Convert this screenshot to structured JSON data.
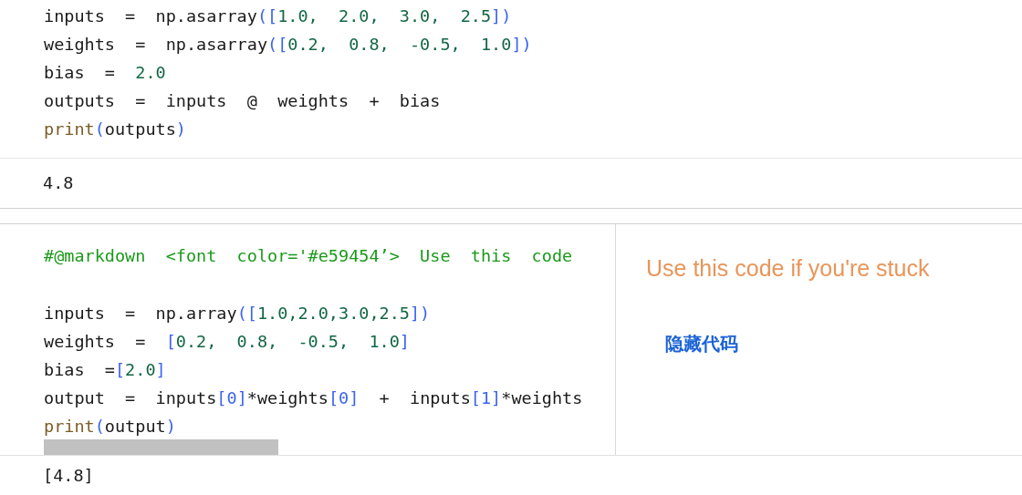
{
  "cells": [
    {
      "code": [
        {
          "tokens": [
            {
              "t": "inputs  =  np.asarray",
              "kind": "plain"
            },
            {
              "t": "([",
              "kind": "bracket"
            },
            {
              "t": "1.0,  2.0,  3.0,  2.5",
              "kind": "number"
            },
            {
              "t": "])",
              "kind": "bracket"
            }
          ]
        },
        {
          "tokens": [
            {
              "t": "weights  =  np.asarray",
              "kind": "plain"
            },
            {
              "t": "([",
              "kind": "bracket"
            },
            {
              "t": "0.2,  0.8,  -0.5,  1.0",
              "kind": "number"
            },
            {
              "t": "])",
              "kind": "bracket"
            }
          ]
        },
        {
          "tokens": [
            {
              "t": "bias  =  ",
              "kind": "plain"
            },
            {
              "t": "2.0",
              "kind": "number"
            }
          ]
        },
        {
          "tokens": [
            {
              "t": "outputs  =  inputs  @  weights  +  bias",
              "kind": "plain"
            }
          ]
        },
        {
          "tokens": [
            {
              "t": "print",
              "kind": "builtin"
            },
            {
              "t": "(",
              "kind": "bracket"
            },
            {
              "t": "outputs",
              "kind": "plain"
            },
            {
              "t": ")",
              "kind": "bracket"
            }
          ]
        }
      ],
      "output": "4.8"
    },
    {
      "comment": "#@markdown  <font  color='#e59454’>  Use  this  code",
      "code": [
        {
          "tokens": [
            {
              "t": "inputs  =  np.array",
              "kind": "plain"
            },
            {
              "t": "([",
              "kind": "bracket"
            },
            {
              "t": "1.0,2.0,3.0,2.5",
              "kind": "number"
            },
            {
              "t": "])",
              "kind": "bracket"
            }
          ]
        },
        {
          "tokens": [
            {
              "t": "weights  =  ",
              "kind": "plain"
            },
            {
              "t": "[",
              "kind": "bracket"
            },
            {
              "t": "0.2,  0.8,  -0.5,  1.0",
              "kind": "number"
            },
            {
              "t": "]",
              "kind": "bracket"
            }
          ]
        },
        {
          "tokens": [
            {
              "t": "bias  =",
              "kind": "plain"
            },
            {
              "t": "[",
              "kind": "bracket"
            },
            {
              "t": "2.0",
              "kind": "number"
            },
            {
              "t": "]",
              "kind": "bracket"
            }
          ]
        },
        {
          "tokens": [
            {
              "t": "output  =  inputs",
              "kind": "plain"
            },
            {
              "t": "[0]",
              "kind": "bracket"
            },
            {
              "t": "*weights",
              "kind": "plain"
            },
            {
              "t": "[0]",
              "kind": "bracket"
            },
            {
              "t": "  +  inputs",
              "kind": "plain"
            },
            {
              "t": "[1]",
              "kind": "bracket"
            },
            {
              "t": "*weights",
              "kind": "plain"
            }
          ]
        },
        {
          "tokens": [
            {
              "t": "print",
              "kind": "builtin"
            },
            {
              "t": "(",
              "kind": "bracket"
            },
            {
              "t": "output",
              "kind": "plain"
            },
            {
              "t": ")",
              "kind": "bracket"
            }
          ]
        }
      ],
      "side_panel": {
        "title": "Use this code if you're stuck",
        "link": "隐藏代码"
      },
      "output": "[4.8]"
    }
  ]
}
